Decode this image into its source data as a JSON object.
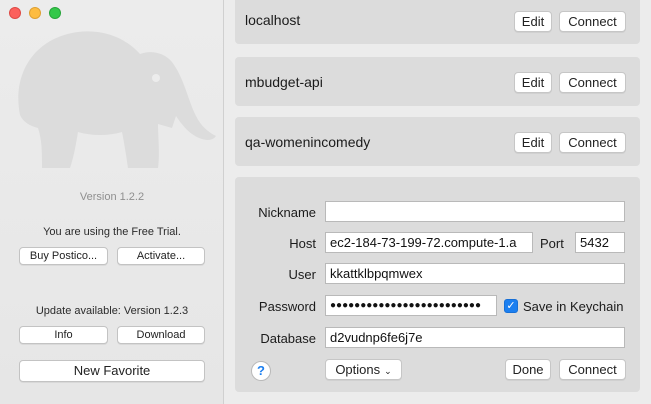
{
  "sidebar": {
    "version": "Version 1.2.2",
    "trial_text": "You are using the Free Trial.",
    "buy_label": "Buy Postico...",
    "activate_label": "Activate...",
    "update_text": "Update available: Version 1.2.3",
    "info_label": "Info",
    "download_label": "Download",
    "new_favorite_label": "New Favorite"
  },
  "favorites": [
    {
      "name": "localhost",
      "edit": "Edit",
      "connect": "Connect"
    },
    {
      "name": "mbudget-api",
      "edit": "Edit",
      "connect": "Connect"
    },
    {
      "name": "qa-womenincomedy",
      "edit": "Edit",
      "connect": "Connect"
    }
  ],
  "form": {
    "nickname_label": "Nickname",
    "nickname_value": "",
    "host_label": "Host",
    "host_value": "ec2-184-73-199-72.compute-1.a",
    "port_label": "Port",
    "port_value": "5432",
    "user_label": "User",
    "user_value": "kkattklbpqmwex",
    "password_label": "Password",
    "password_value": "●●●●●●●●●●●●●●●●●●●●●●●●●",
    "save_keychain_label": "Save in Keychain",
    "save_keychain_checked": true,
    "database_label": "Database",
    "database_value": "d2vudnp6fe6j7e",
    "help_label": "?",
    "options_label": "Options",
    "done_label": "Done",
    "connect_label": "Connect"
  },
  "colors": {
    "accent": "#1b7ff0",
    "window_bg": "#ececec",
    "card_bg": "#dcdcdc"
  }
}
